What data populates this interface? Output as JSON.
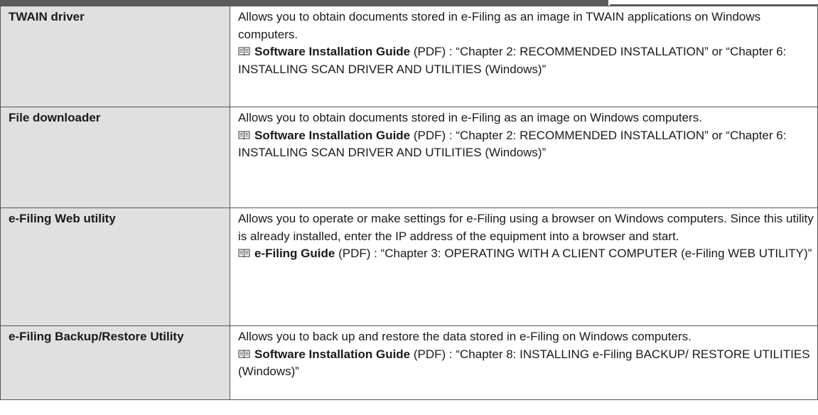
{
  "rows": [
    {
      "name": "TWAIN driver",
      "description": "Allows you to obtain documents stored in e-Filing as an image in TWAIN applications on Windows computers.",
      "guide": "Software Installation Guide",
      "reference": " (PDF) : “Chapter 2: RECOMMENDED INSTALLATION” or “Chapter 6: INSTALLING SCAN DRIVER AND UTILITIES (Windows)”",
      "icon": "book-icon"
    },
    {
      "name": "File downloader",
      "description": "Allows you to obtain documents stored in e-Filing as an image on Windows computers.",
      "guide": "Software Installation Guide",
      "reference": " (PDF) : “Chapter 2: RECOMMENDED INSTALLATION” or “Chapter 6: INSTALLING SCAN DRIVER AND UTILITIES (Windows)”",
      "icon": "book-icon"
    },
    {
      "name": "e-Filing Web utility",
      "description": "Allows you to operate or make settings for e-Filing using a browser on Windows computers. Since this utility is already installed, enter the IP address of the equipment into a browser and start.",
      "guide": "e-Filing Guide",
      "reference": " (PDF) : “Chapter 3: OPERATING WITH A CLIENT COMPUTER (e-Filing WEB UTILITY)”",
      "icon": "book-icon"
    },
    {
      "name": "e-Filing Backup/Restore Utility",
      "description": "Allows you to back up and restore the data stored in e-Filing on Windows computers.",
      "guide": "Software Installation Guide",
      "reference": " (PDF) : “Chapter 8: INSTALLING e-Filing BACKUP/ RESTORE UTILITIES (Windows)”",
      "icon": "book-icon"
    }
  ]
}
